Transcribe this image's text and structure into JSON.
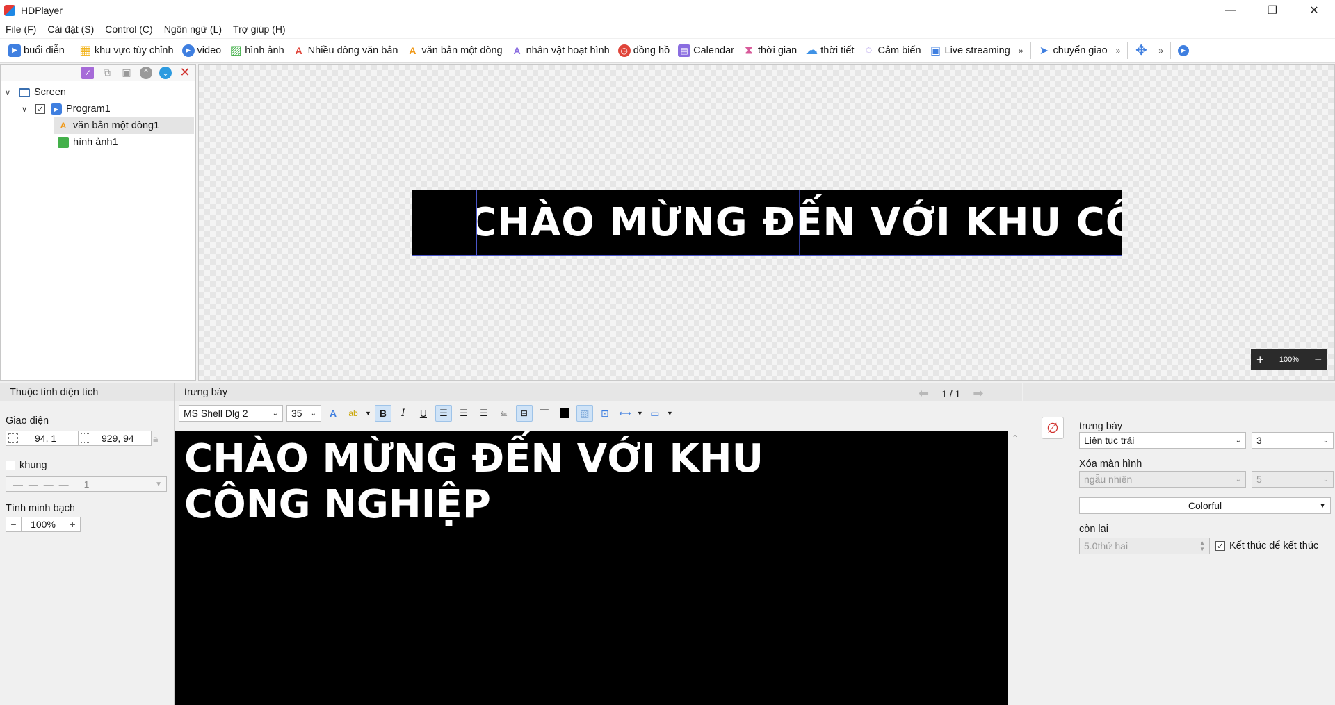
{
  "window": {
    "title": "HDPlayer",
    "minimize": "—",
    "restore": "❐",
    "close": "✕"
  },
  "menu": [
    {
      "label": "File (F)"
    },
    {
      "label": "Cài đặt (S)"
    },
    {
      "label": "Control (C)"
    },
    {
      "label": "Ngôn ngữ (L)"
    },
    {
      "label": "Trợ giúp (H)"
    }
  ],
  "toolbar": {
    "items": [
      {
        "label": "buổi diễn",
        "icon": "program-icon",
        "glyph": "▶",
        "color": "#3f7fe0"
      },
      {
        "label": "khu vực tùy chỉnh",
        "icon": "custom-area-icon",
        "glyph": "▦",
        "color": "#f2b31b"
      },
      {
        "label": "video",
        "icon": "video-icon",
        "glyph": "▶",
        "color": "#3f7fe0"
      },
      {
        "label": "hình ảnh",
        "icon": "image-icon",
        "glyph": "▨",
        "color": "#43b04a"
      },
      {
        "label": "Nhiều dòng văn bản",
        "icon": "multiline-text-icon",
        "glyph": "A",
        "color": "#e0453a"
      },
      {
        "label": "văn bản một dòng",
        "icon": "single-line-text-icon",
        "glyph": "A",
        "color": "#f09a1a"
      },
      {
        "label": "nhân vật hoạt hình",
        "icon": "animated-text-icon",
        "glyph": "A",
        "color": "#8a6de0"
      },
      {
        "label": "đồng hồ",
        "icon": "clock-icon",
        "glyph": "◷",
        "color": "#e0453a"
      },
      {
        "label": "Calendar",
        "icon": "calendar-icon",
        "glyph": "▤",
        "color": "#8a6de0"
      },
      {
        "label": "thời gian",
        "icon": "hourglass-icon",
        "glyph": "⧗",
        "color": "#d85a9a"
      },
      {
        "label": "thời tiết",
        "icon": "weather-icon",
        "glyph": "☁",
        "color": "#3f92e6"
      },
      {
        "label": "Cảm biến",
        "icon": "sensor-icon",
        "glyph": "◌",
        "color": "#8a6de0"
      },
      {
        "label": "Live streaming",
        "icon": "live-streaming-icon",
        "glyph": "▣",
        "color": "#3f7fe0"
      }
    ],
    "more1": "»",
    "transfer": {
      "label": "chuyển giao",
      "icon": "send-icon",
      "glyph": "➤",
      "color": "#3f7fe0"
    },
    "more2": "»",
    "move_glyph": "✥",
    "more3": "»",
    "play_glyph": "▶"
  },
  "tree": {
    "screen": "Screen",
    "program": "Program1",
    "children": [
      {
        "label": "văn bản một dòng1",
        "icon": "single-line-text-icon"
      },
      {
        "label": "hình ảnh1",
        "icon": "image-icon"
      }
    ]
  },
  "canvas": {
    "marquee_text": "CHÀO MỪNG ĐẾN VỚI KHU CÔNG NGHIỆP",
    "zoom": "100%"
  },
  "area_props": {
    "header": "Thuộc tính diện tích",
    "interface_label": "Giao diện",
    "position": "94, 1",
    "size": "929, 94",
    "frame_label": "khung",
    "frame_value": "1",
    "transparency_label": "Tính minh bạch",
    "transparency_value": "100%"
  },
  "display": {
    "header": "trưng bày",
    "page": "1 / 1",
    "font": "MS Shell Dlg 2",
    "font_size": "35",
    "text_lines": [
      "CHÀO MỪNG ĐẾN VỚI KHU",
      "CÔNG NGHIỆP"
    ],
    "text_color": "#ffffff",
    "bg_color": "#000000"
  },
  "effects": {
    "display_label": "trưng bày",
    "display_value": "Liên tục trái",
    "display_speed": "3",
    "clear_label": "Xóa màn hình",
    "clear_value": "ngẫu nhiên",
    "clear_speed": "5",
    "color_mode": "Colorful",
    "remain_label": "còn lại",
    "remain_value": "5.0thứ hai",
    "end_checkbox_label": "Kết thúc để kết thúc"
  }
}
